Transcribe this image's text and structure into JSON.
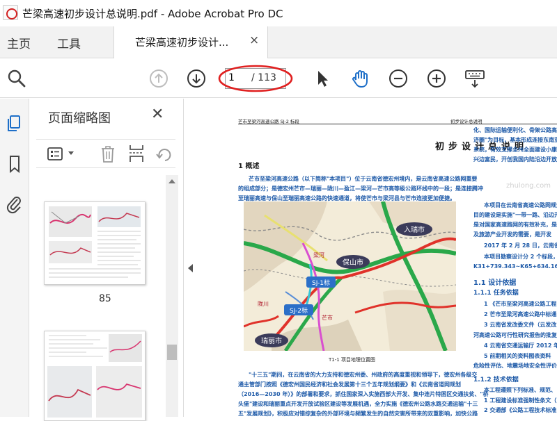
{
  "window": {
    "title": "芒梁高速初步设计总说明.pdf - Adobe Acrobat Pro DC"
  },
  "menu": {
    "home": "主页",
    "tools": "工具"
  },
  "tab": {
    "label": "芒梁高速初步设计...",
    "close": "×"
  },
  "toolbar": {
    "page_current": "1",
    "page_total": "/ 113"
  },
  "thumbnails": {
    "title": "页面缩略图",
    "close": "✕",
    "page_label": "85"
  },
  "document": {
    "header_left": "芒市至梁河高速公路 SJ-2 标段",
    "header_right": "初步设计总说明",
    "title": "初步设计总说明",
    "section1": "1 概述",
    "p1_l1": "芒市至梁河高速公路（以下简称\"本项目\"）位于云南省德宏州境内，是云南省高速公路网重要",
    "p1_l2": "的组成部分；是德宏州芒市—瑞丽—陇川—盈江—梁河—芒市高等级公路环线中的一段；是连接腾冲",
    "p1_l3": "至瑞丽高速与保山至瑞丽高速公路的快速通道，将使芒市与梁河县与芒市连接更加便捷。",
    "right_l1": "化、国际运输便利化、骨架公路高",
    "right_l2": "济圈\"为目标，基本形成连接东南亚",
    "right_l3": "系统，有效支撑全州全面建设小康",
    "right_l4": "兴边富民，开创我国内陆沿边开放",
    "right_l5": "本项目在云南省高速公路网规划",
    "right_l6": "目的建设是实施\"一带一路、沿边开",
    "right_l7": "是对国家高速路网的有效补充，是",
    "right_l8": "及旅游产业开发的需要，是开发",
    "right_l9": "2017 年 2 月 28 日，云南省发",
    "right_l10": "本项目勘察设计分 2 个标段，",
    "right_l11": "K31+739.343~K65+634.162 及起",
    "sec11": "1.1 设计依据",
    "sec111": "1.1.1 任务依据",
    "r_item1": "1 《芒市至梁河高速公路工程",
    "r_item2": "2 芒市至梁河高速公路中标通",
    "r_item3": "3 云南省发改委文件（云发改",
    "r_item3b": "河高速公路可行性研究报告的批复",
    "r_item4": "4 云南省交通运输厅 2012 年",
    "r_item5": "5 前期相关的资料图表资料",
    "r_item5b": "危险性评估、地震场地安全性评价",
    "sec112": "1.1.2 技术依据",
    "r_t1": "本工程遵照下列标准、规范、",
    "r_t2": "1 工程建设标准强制性条文（",
    "r_t3": "2 交通部《公路工程技术标准",
    "map_caption": "T1-1 项目地理位置图",
    "p2_l1": "\"十三五\"期间，在云南省的大力支持和德宏州委、州政府的高度重视和领导下，德宏州各级交",
    "p2_l2": "通主管部门按照《德宏州国民经济和社会发展第十三个五年规划纲要》和《云南省道网规划",
    "p2_l3": "（2016—2030 年）》的部署和要求，抓住国家深入实施西部大开发、集中连片特困区交通扶贫、\"桥",
    "p2_l4": "头堡\"建设和瑞丽重点开发开放试验区建设等发展机遇，全力实施《德宏州公路水路交通运输\"十三",
    "p2_l5": "五\"发展规划》，积极应对错综复杂的外部环境与频繁发生的自然灾害所带来的双重影响，加快公路",
    "map_labels": {
      "ruili": "入瑞市",
      "baoshan": "保山市",
      "sj1": "SJ-1标",
      "sj2": "SJ-2标",
      "ruili2": "瑞丽市",
      "lianghe": "梁河",
      "mangshi": "芒市",
      "longchuan": "陇川"
    },
    "watermark": "zhulong.com"
  },
  "colors": {
    "accent": "#1e5aa8",
    "annotation": "#e02020",
    "route": "#e0322a",
    "green_road": "#2aa84a"
  }
}
